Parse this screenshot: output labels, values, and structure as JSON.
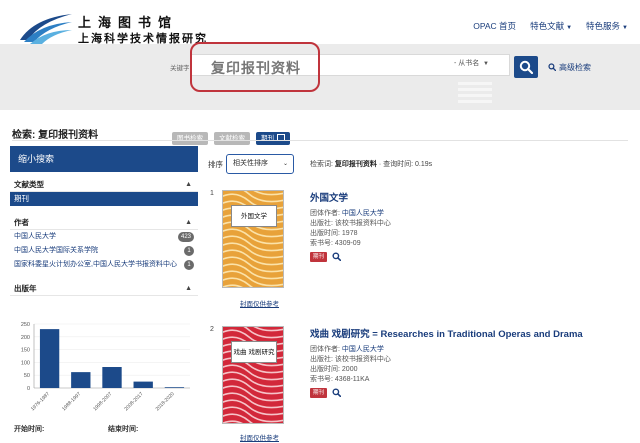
{
  "header": {
    "logo_line1": "上海图书馆",
    "logo_line2": "上海科学技术情报研究所",
    "nav": [
      {
        "label": "OPAC 首页",
        "has_caret": false
      },
      {
        "label": "特色文献",
        "has_caret": true
      },
      {
        "label": "特色服务",
        "has_caret": true
      }
    ]
  },
  "search": {
    "scope_label": "关键字",
    "query": "复印报刊资料",
    "field_label": "- 从书名",
    "advanced_label": "高级检索",
    "format_buttons": [
      {
        "label": "图书检索",
        "style": "grey"
      },
      {
        "label": "文献检索",
        "style": "grey"
      },
      {
        "label": "期刊",
        "style": "navy"
      }
    ]
  },
  "page": {
    "title": "检索: 复印报刊资料"
  },
  "sidebar": {
    "heading": "缩小搜索",
    "doctype_heading": "文献类型",
    "doctype_selected": "期刊",
    "author_heading": "作者",
    "authors": [
      {
        "name": "中国人民大学",
        "count": "423"
      },
      {
        "name": "中国人民大学国际关系学院",
        "count": "1"
      },
      {
        "name": "国家科委星火计划办公室,中国人民大学书报资料中心",
        "count": "1"
      }
    ],
    "year_heading": "出版年",
    "year_chart": {
      "type": "bar",
      "categories": [
        "1976-1987",
        "1988-1997",
        "1998-2007",
        "2008-2017",
        "2018-2020"
      ],
      "values": [
        230,
        62,
        82,
        25,
        3
      ],
      "y_ticks": [
        "250",
        "200",
        "150",
        "100",
        "50",
        "0"
      ],
      "ylim": [
        0,
        250
      ],
      "bar_color": "#1c4a8a"
    },
    "start_time_label": "开始时间:",
    "end_time_label": "结束时间:"
  },
  "results_toolbar": {
    "sort_label": "排序",
    "sort_value": "相关性排序",
    "query_label": "检索词:",
    "query_value": "复印报刊资料",
    "time_label": "查询时间: 0.19s"
  },
  "results": [
    {
      "num": "1",
      "title": "外国文学",
      "cover_text": "外国文学",
      "cover_color": "#e8a23a",
      "stripe_color": "#fbe2a8",
      "cover_link": "封面仅供参考",
      "author_label": "团体作者:",
      "author": "中国人民大学",
      "publisher_label": "出版社:",
      "publisher": "该校书报资料中心",
      "year_label": "出版时间:",
      "year": "1978",
      "issn_label": "索书号:",
      "issn": "4309-09",
      "badge": "期刊"
    },
    {
      "num": "2",
      "title": "戏曲 戏剧研究 = Researches in Traditional Operas and Drama",
      "cover_text": "戏曲 戏剧研究",
      "cover_color": "#d2283a",
      "stripe_color": "#f6c3c8",
      "cover_link": "封面仅供参考",
      "author_label": "团体作者:",
      "author": "中国人民大学",
      "publisher_label": "出版社:",
      "publisher": "该校书报资料中心",
      "year_label": "出版时间:",
      "year": "2000",
      "issn_label": "索书号:",
      "issn": "4368-11KA",
      "badge": "期刊"
    }
  ]
}
